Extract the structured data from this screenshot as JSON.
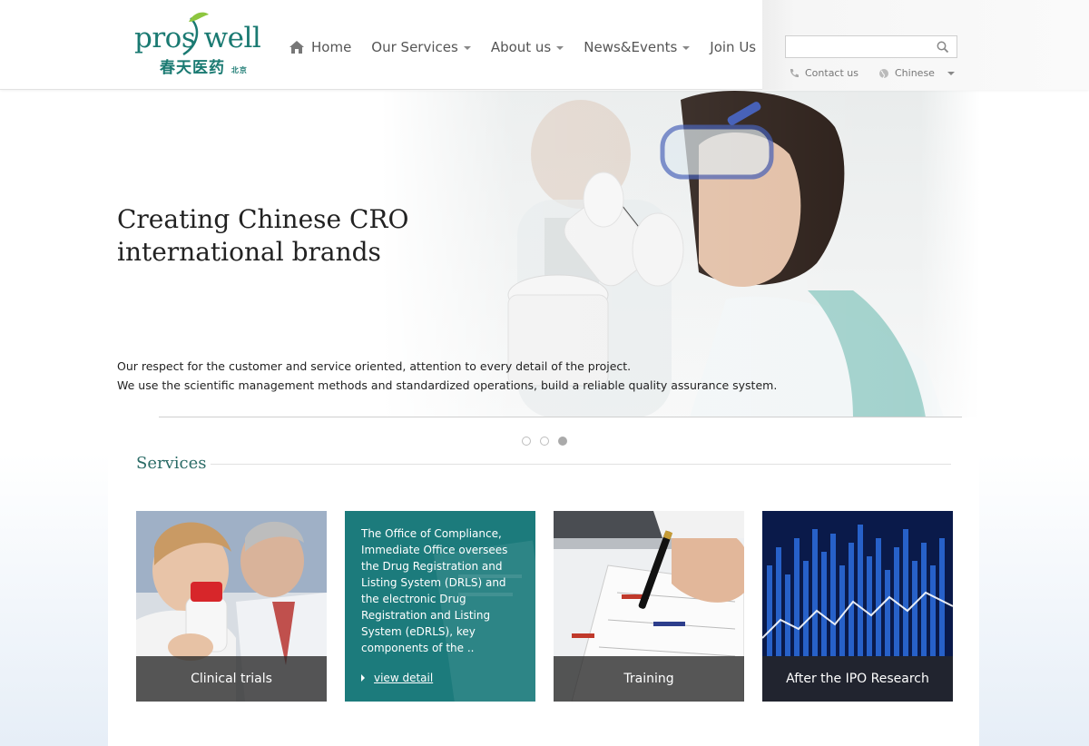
{
  "brand": {
    "logo_text": "pros well",
    "logo_cn": "春天医药",
    "logo_sub": "北京"
  },
  "nav": {
    "items": [
      {
        "label": "Home",
        "icon": "home-icon",
        "dropdown": false
      },
      {
        "label": "Our Services",
        "dropdown": true
      },
      {
        "label": "About us",
        "dropdown": true
      },
      {
        "label": "News&Events",
        "dropdown": true
      },
      {
        "label": "Join Us",
        "dropdown": false
      }
    ]
  },
  "search": {
    "placeholder": "",
    "value": ""
  },
  "utility": {
    "contact_label": "Contact us",
    "language_label": "Chinese"
  },
  "hero": {
    "title": "Creating Chinese CRO international brands",
    "description_line1": "Our respect for the customer and service oriented, attention to every detail of the project.",
    "description_line2": "We use the scientific management methods and standardized operations, build a reliable quality assurance system.",
    "slides_count": 3,
    "active_slide": 3
  },
  "services": {
    "heading": "Services",
    "cards": [
      {
        "caption": "Clinical trials"
      },
      {
        "text": "The Office of Compliance, Immediate Office oversees the Drug Registration and Listing System (DRLS) and the electronic Drug Registration and Listing System (eDRLS), key components of the ..",
        "link": "view detail"
      },
      {
        "caption": "Training"
      },
      {
        "caption": "After the IPO Research"
      }
    ]
  },
  "colors": {
    "brand_teal": "#1a7a72",
    "card_teal": "#1c7b7c",
    "nav_text": "#555555"
  }
}
